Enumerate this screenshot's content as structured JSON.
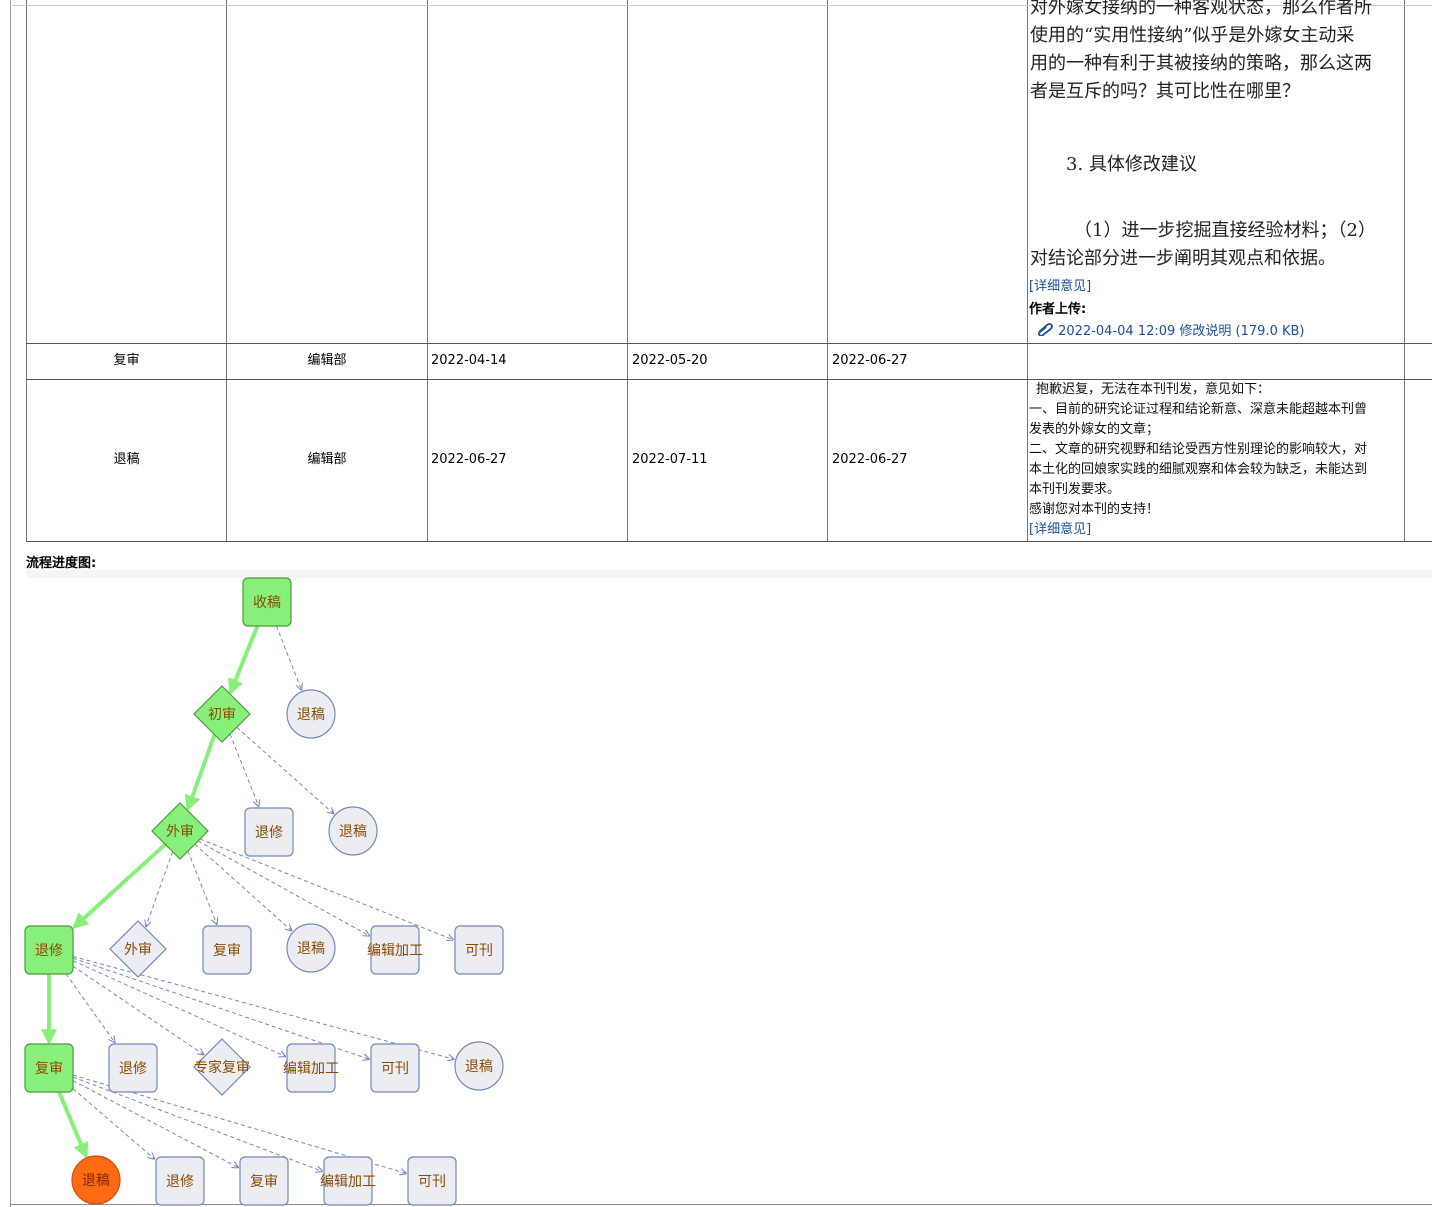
{
  "review_top": {
    "para_lines": [
      "对外嫁女接纳的一种客观状态，那么作者所",
      "使用的“实用性接纳”似乎是外嫁女主动采",
      "用的一种有利于其被接纳的策略，那么这两",
      "者是互斥的吗？其可比性在哪里？"
    ],
    "heading": "3. 具体修改建议",
    "suggest_lines": [
      "（1）进一步挖掘直接经验材料；（2）",
      "对结论部分进一步阐明其观点和依据。"
    ],
    "detail_link": "[详细意见]",
    "author_upload_label": "作者上传:",
    "attachment": "2022-04-04 12:09 修改说明 (179.0 KB)"
  },
  "rows": [
    {
      "stage": "复审",
      "dept": "编辑部",
      "d1": "2022-04-14",
      "d2": "2022-05-20",
      "d3": "2022-06-27"
    },
    {
      "stage": "退稿",
      "dept": "编辑部",
      "d1": "2022-06-27",
      "d2": "2022-07-11",
      "d3": "2022-06-27",
      "opinion_lines": [
        "抱歉迟复，无法在本刊刊发，意见如下：",
        "一、目前的研究论证过程和结论新意、深意未能超越本刊曾",
        "发表的外嫁女的文章；",
        "二、文章的研究视野和结论受西方性别理论的影响较大，对",
        "本土化的回娘家实践的细腻观察和体会较为缺乏，未能达到",
        "本刊刊发要求。",
        "感谢您对本刊的支持！"
      ],
      "detail_link": "[详细意见]"
    }
  ],
  "flow": {
    "title": "流程进度图:",
    "colors": {
      "done": "#88f07a",
      "done_border": "#4a9a3d",
      "pending": "#ecedf3",
      "pending_border": "#7388b8",
      "final": "#ff6a13",
      "text": "#8a4a00",
      "arrow": "#7388b8"
    },
    "nodes": [
      {
        "id": "n1",
        "label": "收稿",
        "shape": "rect",
        "state": "done"
      },
      {
        "id": "n2",
        "label": "初审",
        "shape": "diamond",
        "state": "done"
      },
      {
        "id": "n3",
        "label": "退稿",
        "shape": "circle",
        "state": "pending"
      },
      {
        "id": "n4",
        "label": "外审",
        "shape": "diamond",
        "state": "done"
      },
      {
        "id": "n5",
        "label": "退修",
        "shape": "rect",
        "state": "pending"
      },
      {
        "id": "n6",
        "label": "退稿",
        "shape": "circle",
        "state": "pending"
      },
      {
        "id": "n7",
        "label": "退修",
        "shape": "rect",
        "state": "done"
      },
      {
        "id": "n8",
        "label": "外审",
        "shape": "diamond",
        "state": "pending"
      },
      {
        "id": "n9",
        "label": "复审",
        "shape": "rect",
        "state": "pending"
      },
      {
        "id": "n10",
        "label": "退稿",
        "shape": "circle",
        "state": "pending"
      },
      {
        "id": "n11",
        "label": "编辑加工",
        "shape": "rect",
        "state": "pending"
      },
      {
        "id": "n12",
        "label": "可刊",
        "shape": "rect",
        "state": "pending"
      },
      {
        "id": "n13",
        "label": "复审",
        "shape": "rect",
        "state": "done"
      },
      {
        "id": "n14",
        "label": "退修",
        "shape": "rect",
        "state": "pending"
      },
      {
        "id": "n15",
        "label": "专家复审",
        "shape": "diamond",
        "state": "pending"
      },
      {
        "id": "n16",
        "label": "编辑加工",
        "shape": "rect",
        "state": "pending"
      },
      {
        "id": "n17",
        "label": "可刊",
        "shape": "rect",
        "state": "pending"
      },
      {
        "id": "n18",
        "label": "退稿",
        "shape": "circle",
        "state": "pending"
      },
      {
        "id": "n19",
        "label": "退稿",
        "shape": "circle",
        "state": "final"
      },
      {
        "id": "n20",
        "label": "退修",
        "shape": "rect",
        "state": "pending"
      },
      {
        "id": "n21",
        "label": "复审",
        "shape": "rect",
        "state": "pending"
      },
      {
        "id": "n22",
        "label": "编辑加工",
        "shape": "rect",
        "state": "pending"
      },
      {
        "id": "n23",
        "label": "可刊",
        "shape": "rect",
        "state": "pending"
      }
    ],
    "edges": [
      {
        "from": "n1",
        "to": "n2",
        "type": "main"
      },
      {
        "from": "n1",
        "to": "n3",
        "type": "option"
      },
      {
        "from": "n2",
        "to": "n4",
        "type": "main"
      },
      {
        "from": "n2",
        "to": "n5",
        "type": "option"
      },
      {
        "from": "n2",
        "to": "n6",
        "type": "option"
      },
      {
        "from": "n4",
        "to": "n7",
        "type": "main"
      },
      {
        "from": "n4",
        "to": "n8",
        "type": "option"
      },
      {
        "from": "n4",
        "to": "n9",
        "type": "option"
      },
      {
        "from": "n4",
        "to": "n10",
        "type": "option"
      },
      {
        "from": "n4",
        "to": "n11",
        "type": "option"
      },
      {
        "from": "n4",
        "to": "n12",
        "type": "option"
      },
      {
        "from": "n7",
        "to": "n13",
        "type": "main"
      },
      {
        "from": "n7",
        "to": "n14",
        "type": "option"
      },
      {
        "from": "n7",
        "to": "n15",
        "type": "option"
      },
      {
        "from": "n7",
        "to": "n16",
        "type": "option"
      },
      {
        "from": "n7",
        "to": "n17",
        "type": "option"
      },
      {
        "from": "n7",
        "to": "n18",
        "type": "option"
      },
      {
        "from": "n13",
        "to": "n19",
        "type": "main"
      },
      {
        "from": "n13",
        "to": "n20",
        "type": "option"
      },
      {
        "from": "n13",
        "to": "n21",
        "type": "option"
      },
      {
        "from": "n13",
        "to": "n22",
        "type": "option"
      },
      {
        "from": "n13",
        "to": "n23",
        "type": "option"
      }
    ]
  }
}
